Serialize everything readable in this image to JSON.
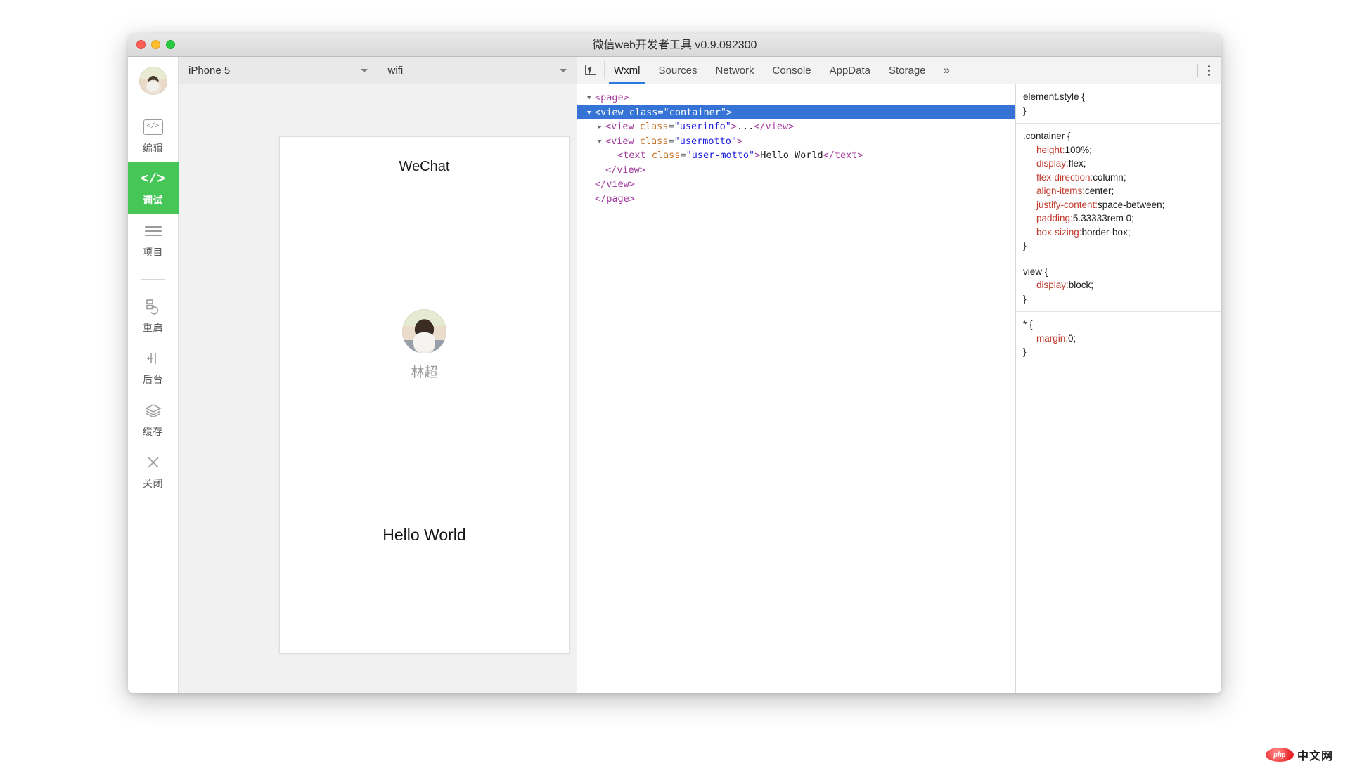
{
  "window": {
    "title": "微信web开发者工具 v0.9.092300",
    "traffic_lights": [
      "close",
      "minimize",
      "maximize"
    ]
  },
  "sidebar": {
    "avatar_name": "user-avatar",
    "items": [
      {
        "label": "编辑",
        "icon": "code-box-icon",
        "active": false
      },
      {
        "label": "调试",
        "icon": "code-angle-icon",
        "active": true
      },
      {
        "label": "项目",
        "icon": "hamburger-icon",
        "active": false
      },
      {
        "label": "重启",
        "icon": "restart-icon",
        "active": false
      },
      {
        "label": "后台",
        "icon": "background-icon",
        "active": false
      },
      {
        "label": "缓存",
        "icon": "layers-icon",
        "active": false
      },
      {
        "label": "关闭",
        "icon": "close-x-icon",
        "active": false
      }
    ]
  },
  "simulator": {
    "device_select": {
      "value": "iPhone 5",
      "placeholder": "iPhone 5"
    },
    "network_select": {
      "value": "wifi",
      "placeholder": "wifi"
    },
    "screen": {
      "page_title": "WeChat",
      "user_name": "林超",
      "motto": "Hello World"
    }
  },
  "devtools": {
    "inspect_icon": "inspect-element-icon",
    "tabs": [
      {
        "label": "Wxml",
        "active": true
      },
      {
        "label": "Sources",
        "active": false
      },
      {
        "label": "Network",
        "active": false
      },
      {
        "label": "Console",
        "active": false
      },
      {
        "label": "AppData",
        "active": false
      },
      {
        "label": "Storage",
        "active": false
      }
    ],
    "more_tabs_label": "»",
    "kebab_label": "more-options",
    "dom_tree": {
      "lines": [
        {
          "arrow": "▼",
          "indent": 0,
          "parts": [
            {
              "t": "tg",
              "v": "<page>"
            }
          ],
          "selected": false
        },
        {
          "arrow": "▼",
          "indent": 1,
          "parts": [
            {
              "t": "tg",
              "v": "<view"
            },
            {
              "t": "sp",
              "v": "  "
            },
            {
              "t": "at",
              "v": "class"
            },
            {
              "t": "eq",
              "v": "="
            },
            {
              "t": "vl",
              "v": "\"container\""
            },
            {
              "t": "tg",
              "v": ">"
            }
          ],
          "selected": true
        },
        {
          "arrow": "▶",
          "indent": 2,
          "parts": [
            {
              "t": "tg",
              "v": "<view"
            },
            {
              "t": "sp",
              "v": "  "
            },
            {
              "t": "at",
              "v": "class"
            },
            {
              "t": "eq",
              "v": "="
            },
            {
              "t": "vl",
              "v": "\"userinfo\""
            },
            {
              "t": "tg",
              "v": ">"
            },
            {
              "t": "tx",
              "v": "..."
            },
            {
              "t": "tg",
              "v": "</view>"
            }
          ],
          "selected": false
        },
        {
          "arrow": "▼",
          "indent": 2,
          "parts": [
            {
              "t": "tg",
              "v": "<view"
            },
            {
              "t": "sp",
              "v": "  "
            },
            {
              "t": "at",
              "v": "class"
            },
            {
              "t": "eq",
              "v": "="
            },
            {
              "t": "vl",
              "v": "\"usermotto\""
            },
            {
              "t": "tg",
              "v": ">"
            }
          ],
          "selected": false
        },
        {
          "arrow": "",
          "indent": 3,
          "parts": [
            {
              "t": "tg",
              "v": "<text"
            },
            {
              "t": "sp",
              "v": "  "
            },
            {
              "t": "at",
              "v": "class"
            },
            {
              "t": "eq",
              "v": "="
            },
            {
              "t": "vl",
              "v": "\"user-motto\""
            },
            {
              "t": "tg",
              "v": ">"
            },
            {
              "t": "tx",
              "v": "Hello World"
            },
            {
              "t": "tg",
              "v": "</text>"
            }
          ],
          "selected": false
        },
        {
          "arrow": "",
          "indent": 2,
          "parts": [
            {
              "t": "tg",
              "v": "</view>"
            }
          ],
          "selected": false
        },
        {
          "arrow": "",
          "indent": 1,
          "parts": [
            {
              "t": "tg",
              "v": "</view>"
            }
          ],
          "selected": false
        },
        {
          "arrow": "",
          "indent": 0,
          "parts": [
            {
              "t": "tg",
              "v": "</page>"
            }
          ],
          "selected": false
        }
      ]
    },
    "styles": {
      "rules": [
        {
          "selector": "element.style {",
          "close": "}",
          "declarations": []
        },
        {
          "selector": ".container {",
          "close": "}",
          "declarations": [
            {
              "prop": "height",
              "value": "100%;",
              "struck": false
            },
            {
              "prop": "display",
              "value": "flex;",
              "struck": false
            },
            {
              "prop": "flex-direction",
              "value": "column;",
              "struck": false
            },
            {
              "prop": "align-items",
              "value": "center;",
              "struck": false
            },
            {
              "prop": "justify-content",
              "value": "space-between;",
              "struck": false
            },
            {
              "prop": "padding",
              "value": "5.33333rem 0;",
              "struck": false
            },
            {
              "prop": "box-sizing",
              "value": "border-box;",
              "struck": false
            }
          ]
        },
        {
          "selector": "view {",
          "close": "}",
          "declarations": [
            {
              "prop": "display",
              "value": "block;",
              "struck": true
            }
          ]
        },
        {
          "selector": "* {",
          "close": "}",
          "declarations": [
            {
              "prop": "margin",
              "value": "0;",
              "struck": false
            }
          ]
        }
      ]
    }
  },
  "watermark": {
    "php": "php",
    "cn": "中文网"
  },
  "colors": {
    "accent_green": "#45c656",
    "selection_blue": "#3574d6",
    "tab_underline": "#2a7ae2",
    "prop_red": "#c0392b",
    "tag_purple": "#a0399c",
    "attr_orange": "#c77023",
    "value_blue": "#1a1ae0"
  }
}
